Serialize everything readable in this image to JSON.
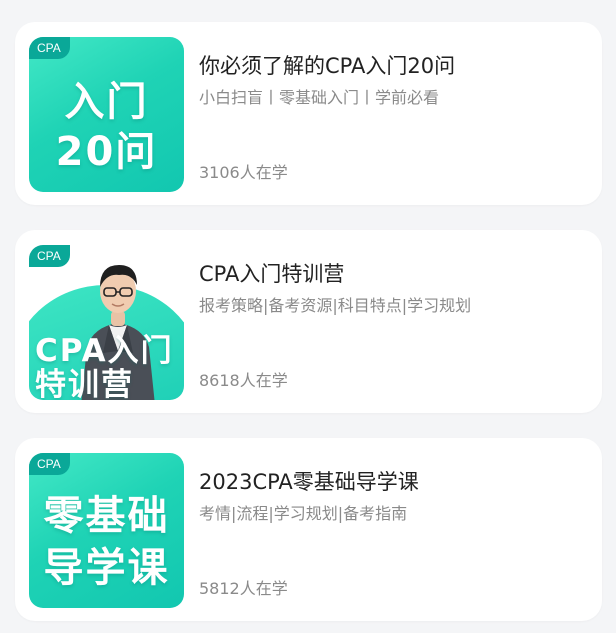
{
  "courses": [
    {
      "tag": "CPA",
      "thumb_line1": "入门",
      "thumb_line2": "20问",
      "title": "你必须了解的CPA入门20问",
      "subtitle": "小白扫盲丨零基础入门丨学前必看",
      "learners": "3106人在学"
    },
    {
      "tag": "CPA",
      "thumb_line1": "CPA入门",
      "thumb_line2": "特训营",
      "title": "CPA入门特训营",
      "subtitle": "报考策略|备考资源|科目特点|学习规划",
      "learners": "8618人在学"
    },
    {
      "tag": "CPA",
      "thumb_line1": "零基础",
      "thumb_line2": "导学课",
      "title": "2023CPA零基础导学课",
      "subtitle": "考情|流程|学习规划|备考指南",
      "learners": "5812人在学"
    }
  ],
  "colors": {
    "accent": "#1fd3b5",
    "tag_bg": "#0aa898",
    "title": "#222222",
    "meta": "#8a8a8a",
    "page_bg": "#f4f5f7"
  }
}
